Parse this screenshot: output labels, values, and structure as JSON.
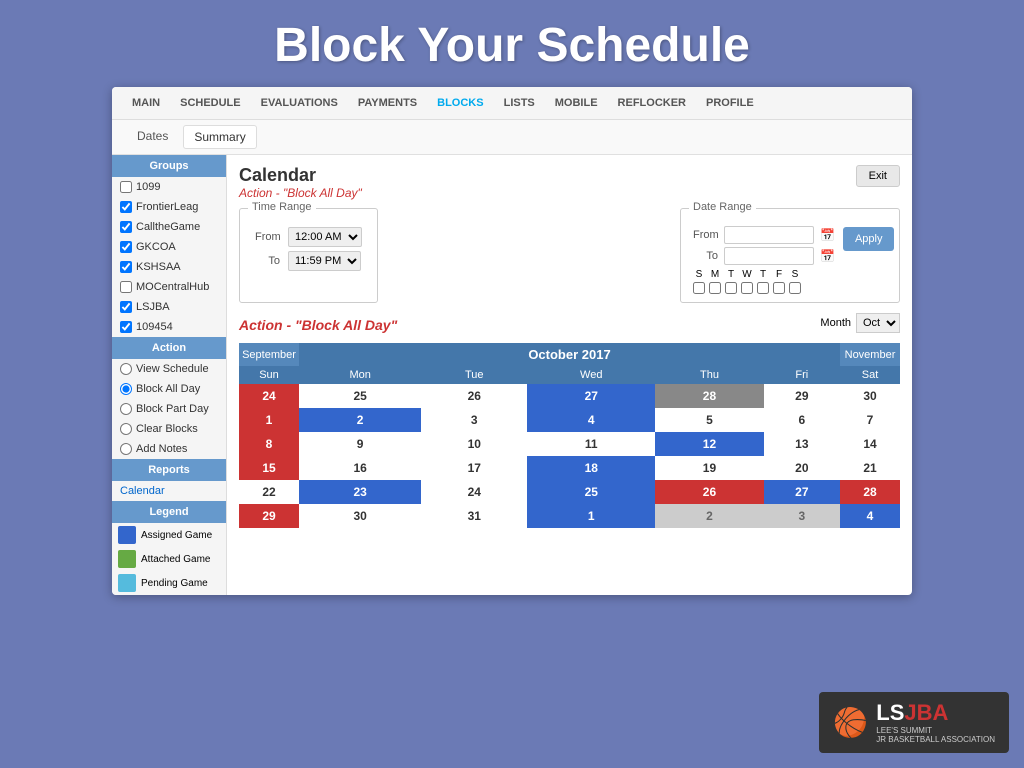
{
  "page": {
    "title": "Block Your Schedule"
  },
  "nav": {
    "items": [
      {
        "label": "MAIN",
        "active": false
      },
      {
        "label": "SCHEDULE",
        "active": false
      },
      {
        "label": "EVALUATIONS",
        "active": false
      },
      {
        "label": "PAYMENTS",
        "active": false
      },
      {
        "label": "BLOCKS",
        "active": true
      },
      {
        "label": "LISTS",
        "active": false
      },
      {
        "label": "MOBILE",
        "active": false
      },
      {
        "label": "REFLOCKER",
        "active": false
      },
      {
        "label": "PROFILE",
        "active": false
      }
    ],
    "sub_items": [
      {
        "label": "Dates",
        "active": false
      },
      {
        "label": "Summary",
        "active": true
      }
    ]
  },
  "sidebar": {
    "groups_label": "Groups",
    "groups": [
      {
        "label": "1099",
        "checked": false,
        "type": "checkbox"
      },
      {
        "label": "FrontierLeag",
        "checked": true,
        "type": "checkbox"
      },
      {
        "label": "CalltheGame",
        "checked": true,
        "type": "checkbox"
      },
      {
        "label": "GKCOA",
        "checked": true,
        "type": "checkbox"
      },
      {
        "label": "KSHSAA",
        "checked": true,
        "type": "checkbox"
      },
      {
        "label": "MOCentralHub",
        "checked": false,
        "type": "checkbox"
      },
      {
        "label": "LSJBA",
        "checked": true,
        "type": "checkbox"
      },
      {
        "label": "109454",
        "checked": true,
        "type": "checkbox"
      }
    ],
    "action_label": "Action",
    "actions": [
      {
        "label": "View Schedule",
        "type": "radio"
      },
      {
        "label": "Block All Day",
        "type": "radio",
        "checked": true
      },
      {
        "label": "Block Part Day",
        "type": "radio"
      },
      {
        "label": "Clear Blocks",
        "type": "radio"
      },
      {
        "label": "Add Notes",
        "type": "radio"
      }
    ],
    "reports_label": "Reports",
    "calendar_link": "Calendar",
    "legend_label": "Legend",
    "legend_items": [
      {
        "label": "Assigned Game",
        "color": "#3366cc"
      },
      {
        "label": "Attached Game",
        "color": "#66aa44"
      },
      {
        "label": "Pending Game",
        "color": "#55bbdd"
      }
    ]
  },
  "calendar": {
    "title": "Calendar",
    "action_subtitle": "Action - \"Block All Day\"",
    "exit_btn": "Exit",
    "time_range_label": "Time Range",
    "from_label": "From",
    "to_label": "To",
    "from_time": "12:00 AM",
    "to_time": "11:59 PM",
    "date_range_label": "Date Range",
    "apply_btn": "Apply",
    "days": [
      "S",
      "M",
      "T",
      "W",
      "T",
      "F",
      "S"
    ],
    "action_heading": "Action - \"Block All Day\"",
    "month_label": "Month",
    "month_value": "Oct",
    "calendar_title": "October 2017",
    "prev_month": "September",
    "next_month": "November",
    "day_headers": [
      "Sun",
      "Mon",
      "Tue",
      "Wed",
      "Thu",
      "Fri",
      "Sat"
    ],
    "weeks": [
      [
        {
          "date": "24",
          "style": "red"
        },
        {
          "date": "25",
          "style": "white"
        },
        {
          "date": "26",
          "style": "white"
        },
        {
          "date": "27",
          "style": "blue"
        },
        {
          "date": "28",
          "style": "gray"
        },
        {
          "date": "29",
          "style": "white"
        },
        {
          "date": "30",
          "style": "white"
        }
      ],
      [
        {
          "date": "1",
          "style": "red"
        },
        {
          "date": "2",
          "style": "blue"
        },
        {
          "date": "3",
          "style": "white"
        },
        {
          "date": "4",
          "style": "blue"
        },
        {
          "date": "5",
          "style": "white"
        },
        {
          "date": "6",
          "style": "white"
        },
        {
          "date": "7",
          "style": "white"
        }
      ],
      [
        {
          "date": "8",
          "style": "red"
        },
        {
          "date": "9",
          "style": "white"
        },
        {
          "date": "10",
          "style": "white"
        },
        {
          "date": "11",
          "style": "white"
        },
        {
          "date": "12",
          "style": "blue"
        },
        {
          "date": "13",
          "style": "white"
        },
        {
          "date": "14",
          "style": "white"
        }
      ],
      [
        {
          "date": "15",
          "style": "red"
        },
        {
          "date": "16",
          "style": "white"
        },
        {
          "date": "17",
          "style": "white"
        },
        {
          "date": "18",
          "style": "blue"
        },
        {
          "date": "19",
          "style": "white"
        },
        {
          "date": "20",
          "style": "white"
        },
        {
          "date": "21",
          "style": "white"
        }
      ],
      [
        {
          "date": "22",
          "style": "white"
        },
        {
          "date": "23",
          "style": "blue"
        },
        {
          "date": "24",
          "style": "white"
        },
        {
          "date": "25",
          "style": "blue"
        },
        {
          "date": "26",
          "style": "red"
        },
        {
          "date": "27",
          "style": "blue"
        },
        {
          "date": "28",
          "style": "red"
        }
      ],
      [
        {
          "date": "29",
          "style": "red"
        },
        {
          "date": "30",
          "style": "white"
        },
        {
          "date": "31",
          "style": "white"
        },
        {
          "date": "1",
          "style": "blue"
        },
        {
          "date": "2",
          "style": "light-gray"
        },
        {
          "date": "3",
          "style": "light-gray"
        },
        {
          "date": "4",
          "style": "blue"
        }
      ]
    ]
  },
  "logo": {
    "ls": "LS",
    "jba": "JBA",
    "line1": "LEE'S SUMMIT",
    "line2": "JR BASKETBALL ASSOCIATION"
  }
}
